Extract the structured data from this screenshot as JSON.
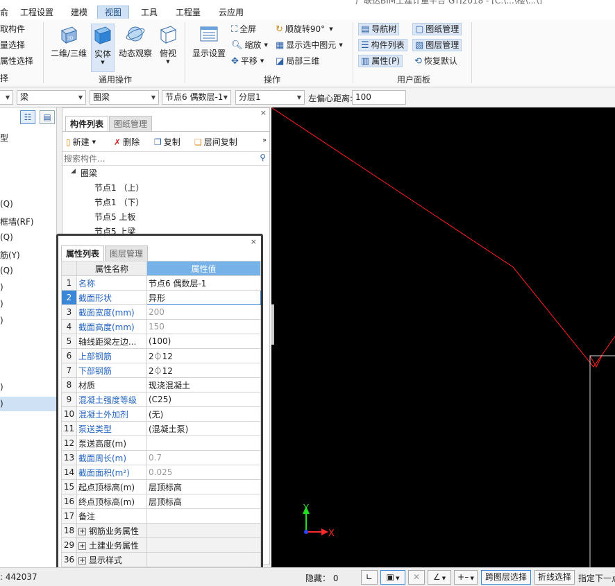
{
  "title_partial": "广联达BIM土建计量平台 GTJ2018 - [C:\\...\\楼\\...\\]",
  "menu": {
    "items": [
      "俞",
      "工程设置",
      "建模",
      "视图",
      "工具",
      "工程量",
      "云应用"
    ]
  },
  "ribbon": {
    "left_clip": {
      "row1": "取构件",
      "row2": "量选择",
      "row3": "属性选择",
      "row4": "择"
    },
    "general_ops": {
      "label": "通用操作",
      "btn_2d3d": "二维/三维",
      "btn_solid": "实体",
      "btn_dyn": "动态观察",
      "btn_top": "俯视"
    },
    "ops": {
      "label": "操作",
      "btn_display": "显示设置",
      "fullscreen": "全屏",
      "zoom": "缩放",
      "pan": "平移",
      "rotate": "顺旋转90°",
      "show_selected": "显示选中图元",
      "local_3d": "局部三维"
    },
    "user_panel": {
      "label": "用户面板",
      "nav_tree": "导航树",
      "comp_list": "构件列表",
      "props": "属性(P)",
      "drawing_mgr": "图纸管理",
      "layer_mgr": "图层管理",
      "restore": "恢复默认"
    }
  },
  "toolbar2": {
    "combo0": "",
    "type": "梁",
    "subtype": "圈梁",
    "component": "节点6  偶数层-1",
    "layer": "分层1",
    "offset_label": "左偏心距离:",
    "offset_value": "100"
  },
  "left_tree": {
    "items": [
      "型",
      "(Q)",
      "框墙(RF)",
      "(Q)",
      "筋(Y)",
      "(Q)",
      ")",
      ")",
      ")",
      ")",
      ")"
    ]
  },
  "comp_panel": {
    "tab_active": "构件列表",
    "tab_inactive": "图纸管理",
    "new": "新建",
    "delete": "删除",
    "copy": "复制",
    "floor_copy": "层间复制",
    "search_placeholder": "搜索构件...",
    "tree_root": "圈梁",
    "nodes": [
      "节点1 （上）",
      "节点1 （下）",
      "节点5  上板",
      "节点5  上梁"
    ]
  },
  "prop_panel": {
    "tab_active": "属性列表",
    "tab_inactive": "图层管理",
    "col_name": "属性名称",
    "col_value": "属性值",
    "rows": [
      {
        "n": "1",
        "name": "名称",
        "value": "节点6  偶数层-1"
      },
      {
        "n": "2",
        "name": "截面形状",
        "value": "异形"
      },
      {
        "n": "3",
        "name": "截面宽度(mm)",
        "value": "200"
      },
      {
        "n": "4",
        "name": "截面高度(mm)",
        "value": "150"
      },
      {
        "n": "5",
        "name": "轴线距梁左边...",
        "value": "(100)"
      },
      {
        "n": "6",
        "name": "上部钢筋",
        "value": "2⏀12"
      },
      {
        "n": "7",
        "name": "下部钢筋",
        "value": "2⏀12"
      },
      {
        "n": "8",
        "name": "材质",
        "value": "现浇混凝土"
      },
      {
        "n": "9",
        "name": "混凝土强度等级",
        "value": "(C25)"
      },
      {
        "n": "10",
        "name": "混凝土外加剂",
        "value": "(无)"
      },
      {
        "n": "11",
        "name": "泵送类型",
        "value": "(混凝土泵)"
      },
      {
        "n": "12",
        "name": "泵送高度(m)",
        "value": ""
      },
      {
        "n": "13",
        "name": "截面周长(m)",
        "value": "0.7"
      },
      {
        "n": "14",
        "name": "截面面积(m²)",
        "value": "0.025"
      },
      {
        "n": "15",
        "name": "起点顶标高(m)",
        "value": "层顶标高"
      },
      {
        "n": "16",
        "name": "终点顶标高(m)",
        "value": "层顶标高"
      },
      {
        "n": "17",
        "name": "备注",
        "value": ""
      },
      {
        "n": "18",
        "name": "钢筋业务属性",
        "value": ""
      },
      {
        "n": "29",
        "name": "土建业务属性",
        "value": ""
      },
      {
        "n": "36",
        "name": "显示样式",
        "value": ""
      }
    ]
  },
  "viewport": {
    "axis_x": "X",
    "axis_y": "Y",
    "line_color": "#ff2020",
    "x_color": "#ff2a2a",
    "y_color": "#22dd22"
  },
  "statusbar": {
    "coord": ": 442037",
    "hidden": "隐藏： 0",
    "cross_layer": "跨图层选择",
    "polyline": "折线选择",
    "next": "指定下一点"
  },
  "colors": {
    "accent": "#3b86d6",
    "header_value": "#76b2e8",
    "blue_text": "#2565c0"
  }
}
